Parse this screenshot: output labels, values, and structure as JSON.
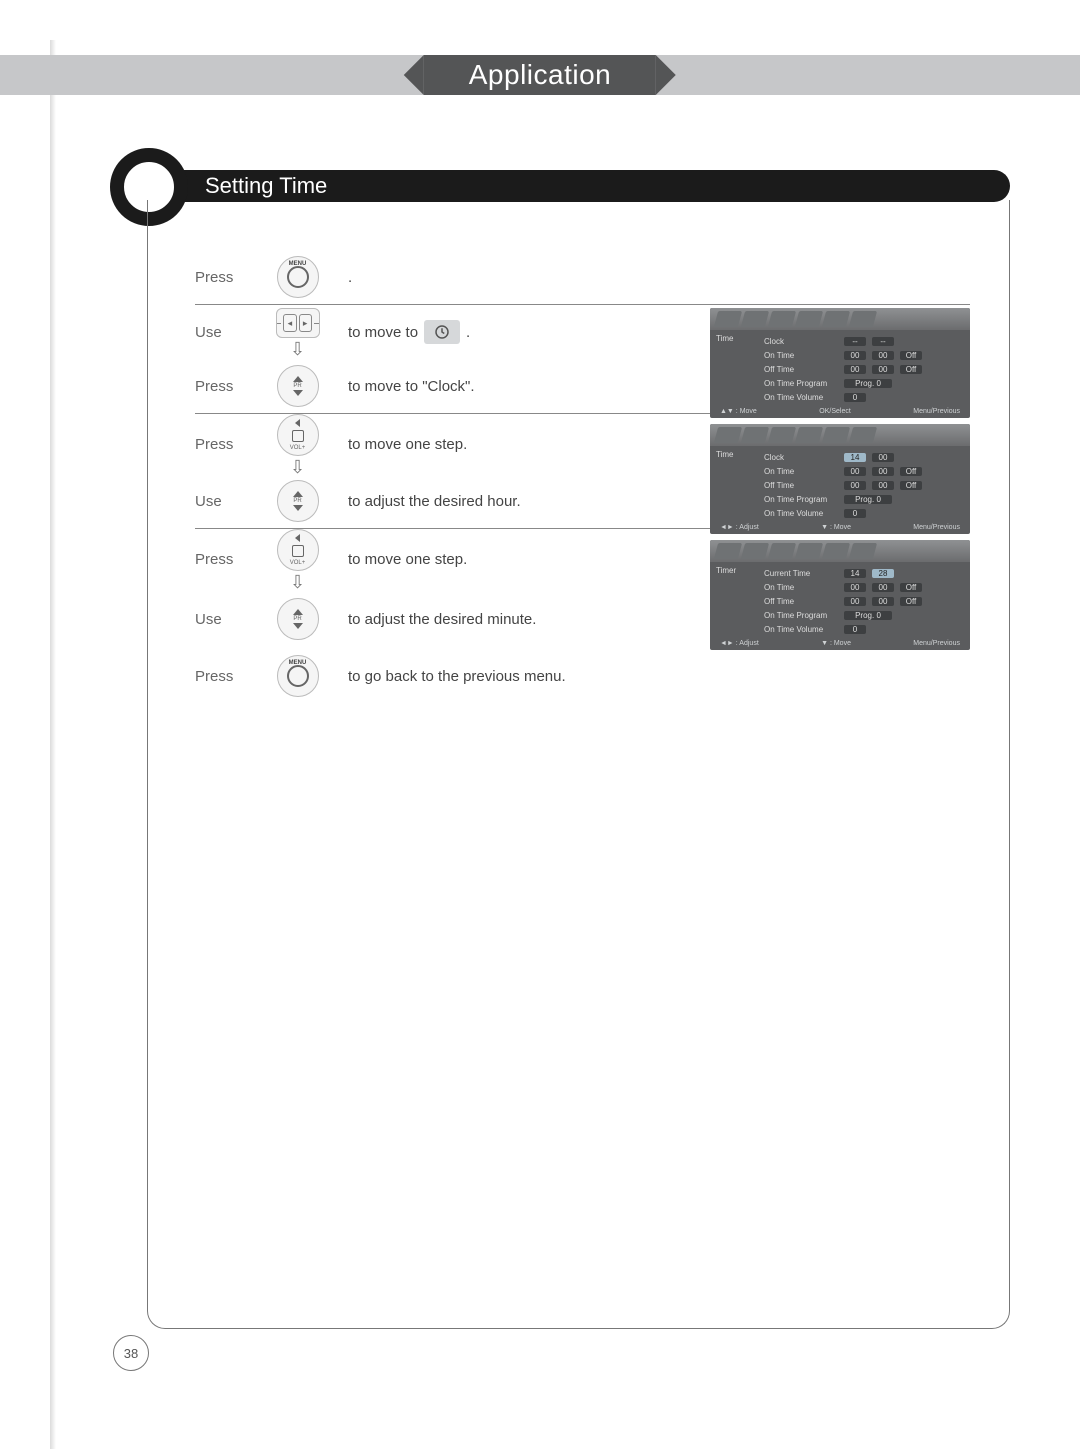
{
  "header": "Application",
  "section": "Setting Time",
  "page_number": "38",
  "steps": [
    {
      "verb": "Press",
      "btn": "menu",
      "desc_pre": "",
      "desc_post": "."
    },
    {
      "verb": "Use",
      "btn": "vol",
      "arrow": true,
      "desc_pre": "to move to",
      "icon": true,
      "desc_post": "."
    },
    {
      "verb": "Press",
      "btn": "pr",
      "hr": true,
      "desc_pre": "to move to \"Clock\".",
      "desc_post": ""
    },
    {
      "verb": "Press",
      "btn": "ok",
      "arrow": true,
      "desc_pre": "to move one step.",
      "desc_post": ""
    },
    {
      "verb": "Use",
      "btn": "pr",
      "hr": true,
      "desc_pre": "to adjust the desired hour.",
      "desc_post": ""
    },
    {
      "verb": "Press",
      "btn": "ok",
      "arrow": true,
      "desc_pre": "to move one step.",
      "desc_post": ""
    },
    {
      "verb": "Use",
      "btn": "pr",
      "desc_pre": "to adjust the desired minute.",
      "desc_post": ""
    },
    {
      "verb": "Press",
      "btn": "menu",
      "desc_pre": "to go back to the previous menu.",
      "desc_post": ""
    }
  ],
  "osd_common": {
    "side_label": "Time",
    "rows": [
      "Clock",
      "On Time",
      "Off Time",
      "On Time Program",
      "On Time Volume"
    ],
    "foot_move": "▲▼ : Move",
    "foot_sel": "OK/Select",
    "foot_prev": "Menu/Previous",
    "foot_adj": "◄► : Adjust",
    "foot_move2": "▼ : Move"
  },
  "osd1": {
    "clock": [
      "--",
      "--"
    ],
    "on": [
      "00",
      "00",
      "Off"
    ],
    "off": [
      "00",
      "00",
      "Off"
    ],
    "prog": "Prog. 0",
    "vol": "0"
  },
  "osd2": {
    "clock": [
      "14",
      "00"
    ],
    "on": [
      "00",
      "00",
      "Off"
    ],
    "off": [
      "00",
      "00",
      "Off"
    ],
    "prog": "Prog. 0",
    "vol": "0"
  },
  "osd3": {
    "label": "Timer",
    "cur": "Current Time",
    "clock": [
      "14",
      "28"
    ],
    "on": [
      "00",
      "00",
      "Off"
    ],
    "off": [
      "00",
      "00",
      "Off"
    ],
    "prog": "Prog. 0",
    "vol": "0"
  }
}
